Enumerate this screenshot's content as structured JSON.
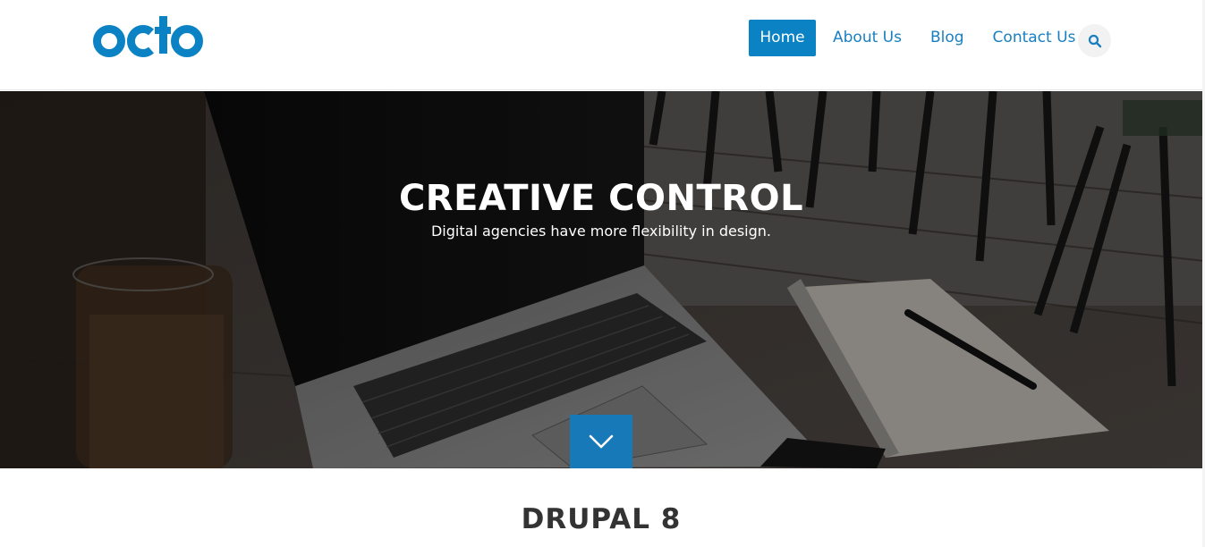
{
  "brand": {
    "logo_text": "octo",
    "color": "#0a82c4"
  },
  "nav": {
    "items": [
      {
        "label": "Home",
        "active": true
      },
      {
        "label": "About Us",
        "active": false
      },
      {
        "label": "Blog",
        "active": false
      },
      {
        "label": "Contact Us",
        "active": false
      }
    ],
    "search_icon": "search-icon"
  },
  "hero": {
    "title": "CREATIVE CONTROL",
    "subtitle": "Digital agencies have more flexibility in design.",
    "scroll_icon": "chevron-down-icon"
  },
  "section": {
    "title": "DRUPAL 8"
  }
}
